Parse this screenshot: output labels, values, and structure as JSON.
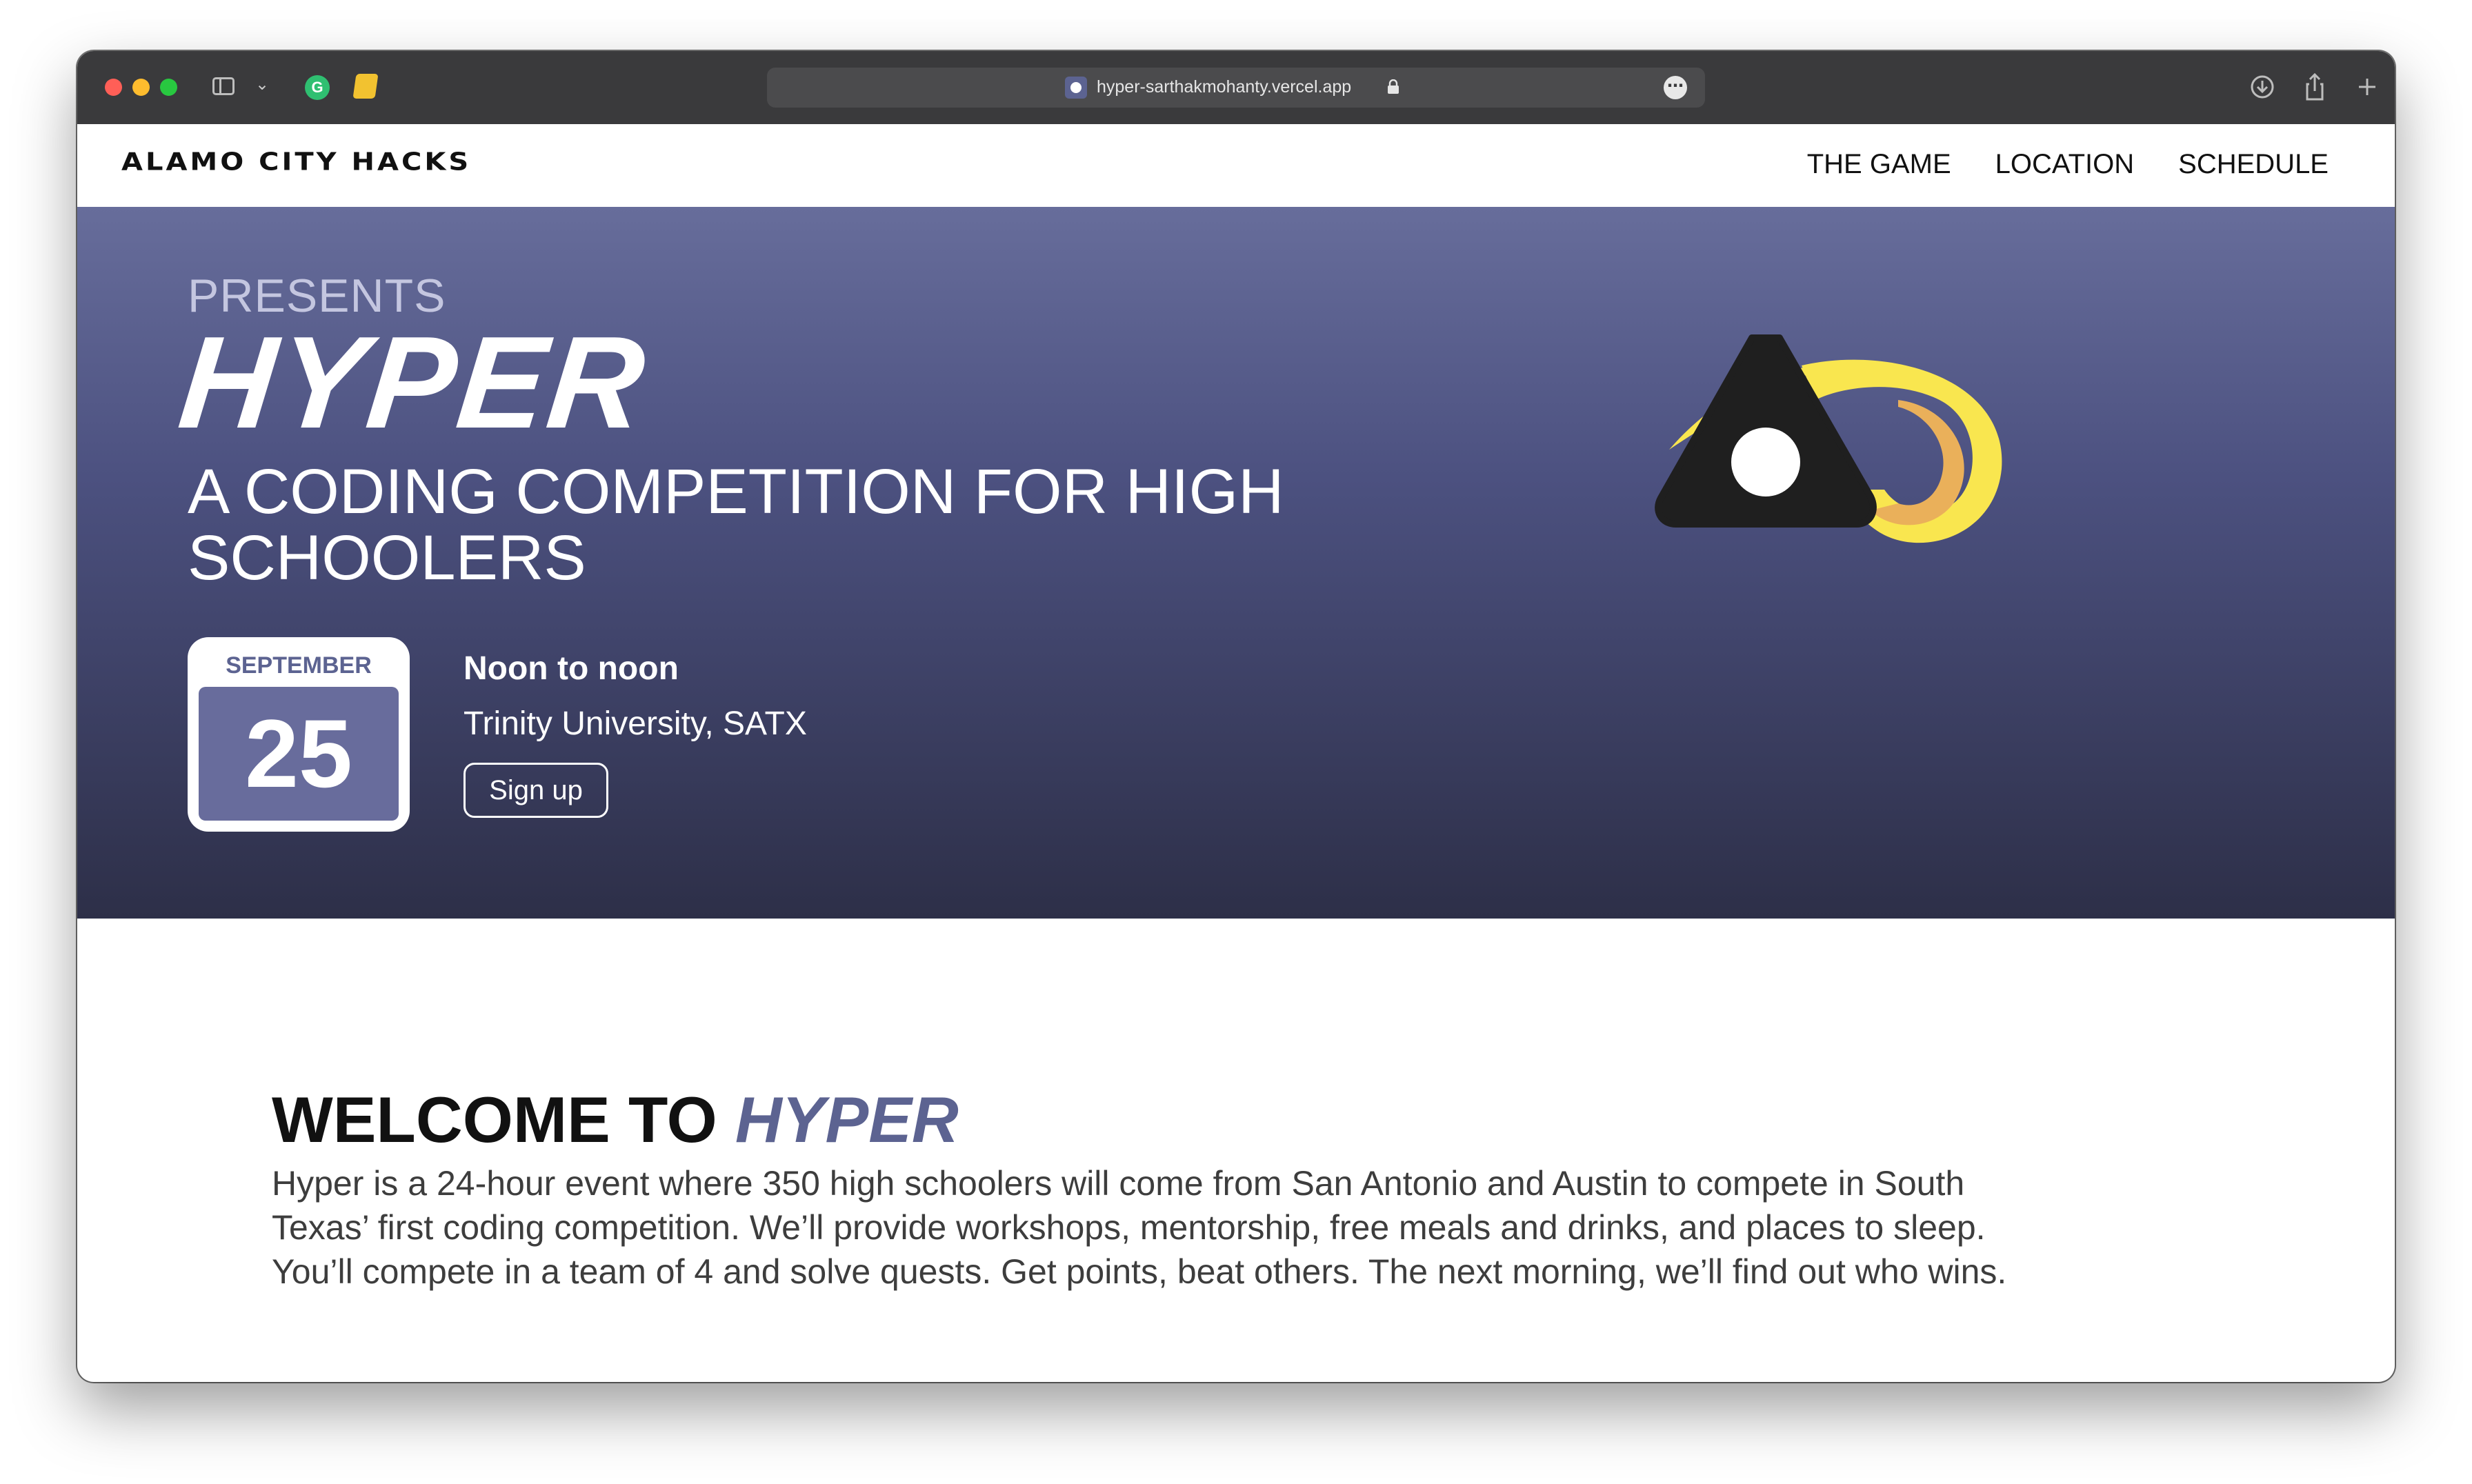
{
  "browser": {
    "url": "hyper-sarthakmohanty.vercel.app",
    "extension_green_label": "G"
  },
  "nav": {
    "brand": "ALAMO CITY HACKS",
    "links": [
      "THE GAME",
      "LOCATION",
      "SCHEDULE"
    ]
  },
  "hero": {
    "presents": "PRESENTS",
    "title": "HYPER",
    "tagline": "A CODING COMPETITION FOR HIGH SCHOOLERS",
    "calendar": {
      "month": "SEPTEMBER",
      "day": "25"
    },
    "time": "Noon to noon",
    "location": "Trinity University, SATX",
    "signup_label": "Sign up",
    "colors": {
      "accent": "#5c6391",
      "logo_yellow": "#f9e64f",
      "logo_orange": "#eab05a",
      "logo_dark": "#1f1f1f"
    }
  },
  "welcome": {
    "title_prefix": "WELCOME TO",
    "title_highlight": "HYPER",
    "body": "Hyper is a 24-hour event where 350 high schoolers will come from San Antonio and Austin to compete in South Texas’ first coding competition. We’ll provide workshops, mentorship, free meals and drinks, and places to sleep. You’ll compete in a team of 4 and solve quests. Get points, beat others. The next morning, we’ll find out who wins."
  }
}
